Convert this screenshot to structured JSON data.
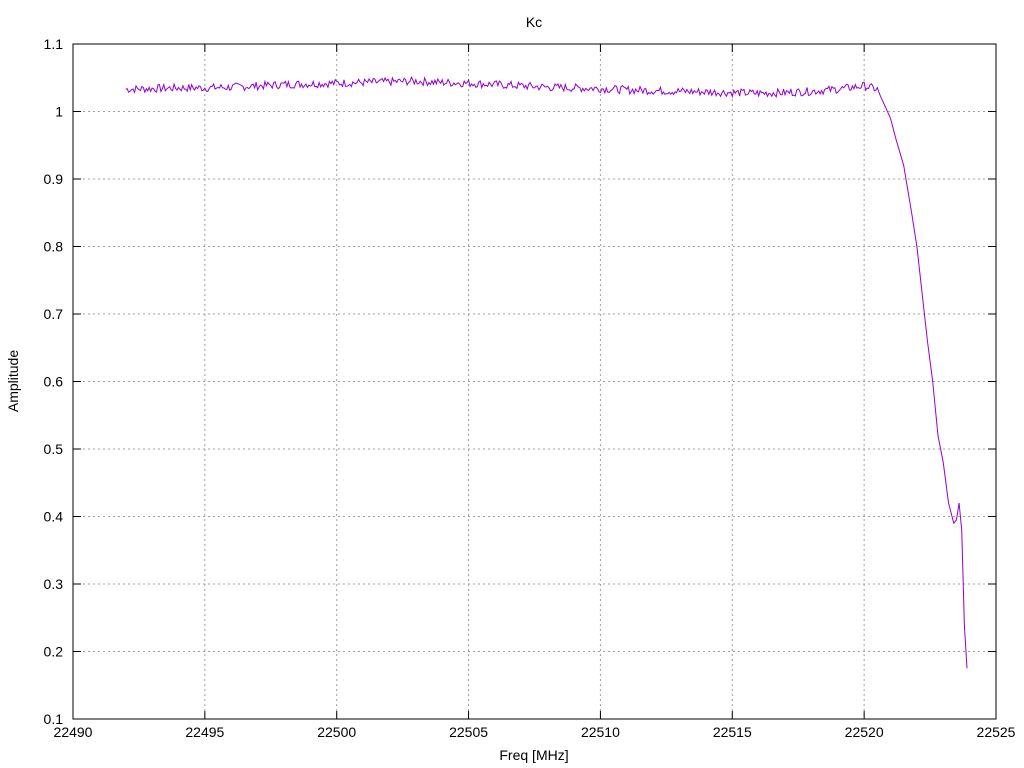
{
  "chart_data": {
    "type": "line",
    "title": "Kc",
    "xlabel": "Freq [MHz]",
    "ylabel": "Amplitude",
    "xlim": [
      22490,
      22525
    ],
    "ylim": [
      0.1,
      1.1
    ],
    "grid": true,
    "legend": "none",
    "x_ticks": [
      "22490",
      "22495",
      "22500",
      "22505",
      "22510",
      "22515",
      "22520",
      "22525"
    ],
    "y_ticks": [
      "0.1",
      "0.2",
      "0.3",
      "0.4",
      "0.5",
      "0.6",
      "0.7",
      "0.8",
      "0.9",
      "1",
      "1.1"
    ],
    "series": [
      {
        "color": "#9400d3",
        "x": [
          22492,
          22493,
          22494,
          22495,
          22496,
          22497,
          22498,
          22499,
          22500,
          22501,
          22502,
          22503,
          22504,
          22505,
          22506,
          22507,
          22508,
          22509,
          22510,
          22511,
          22512,
          22513,
          22514,
          22515,
          22516,
          22517,
          22518,
          22519,
          22520,
          22520.5,
          22521,
          22521.2,
          22521.5,
          22521.8,
          22522,
          22522.2,
          22522.4,
          22522.6,
          22522.8,
          22523,
          22523.2,
          22523.4,
          22523.5,
          22523.6,
          22523.7,
          22523.8,
          22523.9
        ],
        "y": [
          1.033,
          1.034,
          1.035,
          1.035,
          1.036,
          1.038,
          1.04,
          1.041,
          1.042,
          1.043,
          1.044,
          1.045,
          1.043,
          1.042,
          1.04,
          1.038,
          1.036,
          1.035,
          1.034,
          1.032,
          1.031,
          1.03,
          1.029,
          1.028,
          1.027,
          1.028,
          1.03,
          1.033,
          1.038,
          1.033,
          0.99,
          0.96,
          0.92,
          0.85,
          0.8,
          0.73,
          0.66,
          0.6,
          0.52,
          0.48,
          0.42,
          0.39,
          0.395,
          0.42,
          0.38,
          0.24,
          0.175
        ]
      }
    ]
  }
}
